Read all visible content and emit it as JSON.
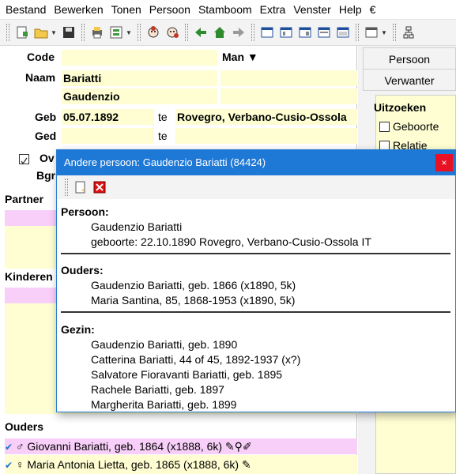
{
  "menu": [
    "Bestand",
    "Bewerken",
    "Tonen",
    "Persoon",
    "Stamboom",
    "Extra",
    "Venster",
    "Help",
    "€"
  ],
  "toolbar_icons": [
    "new-file-icon",
    "open-folder-icon",
    "save-icon",
    "print-icon",
    "tree-icon",
    "person-male-icon",
    "person-female-icon",
    "arrow-left-icon",
    "home-icon",
    "arrow-right-icon",
    "view1-icon",
    "view2-icon",
    "view3-icon",
    "view4-icon",
    "view5-icon",
    "window-icon",
    "network-icon"
  ],
  "form": {
    "code_label": "Code",
    "code_value": "",
    "gender": "Man ▼",
    "naam_label": "Naam",
    "surname": "Bariatti",
    "firstname": "Gaudenzio",
    "geb_label": "Geb",
    "geb_date": "05.07.1892",
    "te1": "te",
    "geb_place": "Rovegro, Verbano-Cusio-Ossola",
    "ged_label": "Ged",
    "te2": "te",
    "ov_label": "Ov",
    "bgr_label": "Bgr",
    "partner_label": "Partner",
    "kinderen_label": "Kinderen",
    "ouders_label": "Ouders",
    "parent1": "Giovanni Bariatti, geb. 1864 (x1888, 6k)",
    "parent2": "Maria Antonia Lietta, geb. 1865 (x1888, 6k)"
  },
  "right": {
    "tab1": "Persoon",
    "tab2": "Verwanter",
    "uitzoeken": "Uitzoeken",
    "cb1": "Geboorte",
    "cb2": "Relatie"
  },
  "dialog": {
    "title": "Andere persoon: Gaudenzio Bariatti (84424)",
    "close": "×",
    "persoon_h": "Persoon:",
    "persoon_lines": [
      "Gaudenzio Bariatti",
      "geboorte: 22.10.1890 Rovegro, Verbano-Cusio-Ossola IT"
    ],
    "ouders_h": "Ouders:",
    "ouders_lines": [
      "Gaudenzio Bariatti, geb. 1866 (x1890, 5k)",
      "Maria Santina, 85, 1868-1953 (x1890, 5k)"
    ],
    "gezin_h": "Gezin:",
    "gezin_lines": [
      "Gaudenzio Bariatti, geb. 1890",
      "Catterina Bariatti, 44 of 45, 1892-1937 (x?)",
      "Salvatore Fioravanti Bariatti, geb. 1895",
      "Rachele Bariatti, geb. 1897",
      "Margherita Bariatti, geb. 1899"
    ]
  }
}
